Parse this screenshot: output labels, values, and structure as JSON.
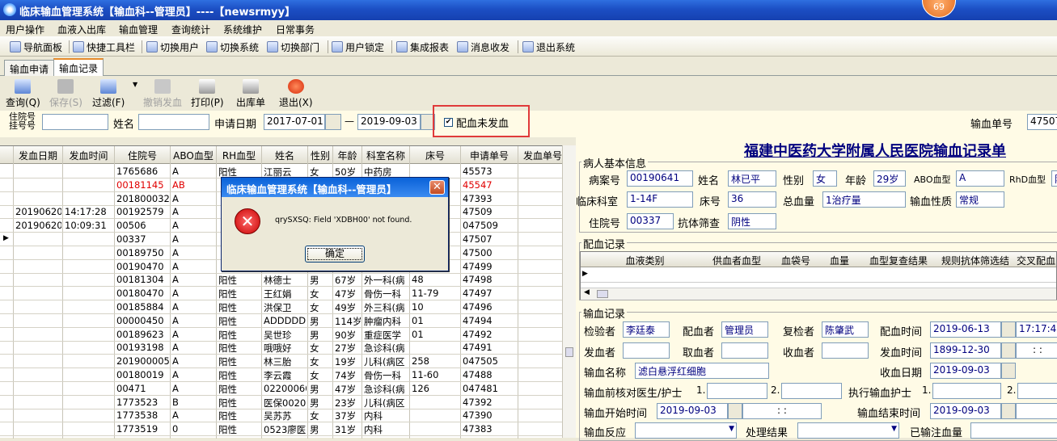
{
  "window": {
    "title": "临床输血管理系统【输血科--管理员】----【newsrmyy】",
    "badge": "69"
  },
  "menu": [
    "用户操作",
    "血液入出库",
    "输血管理",
    "查询统计",
    "系统维护",
    "日常事务"
  ],
  "toolbar": [
    "导航面板",
    "快捷工具栏",
    "切换用户",
    "切换系统",
    "切换部门",
    "用户锁定",
    "集成报表",
    "消息收发",
    "退出系统"
  ],
  "tabs": [
    "输血申请",
    "输血记录"
  ],
  "bigtools": [
    "查询(Q)",
    "保存(S)",
    "过滤(F)",
    "撤销发血",
    "打印(P)",
    "出库单",
    "退出(X)"
  ],
  "filter": {
    "zyh_label1": "住院号",
    "zyh_label2": "挂号号",
    "name_label": "姓名",
    "date_label": "申请日期",
    "date_from": "2017-07-01",
    "dash": "—",
    "date_to": "2019-09-03",
    "checkbox_label": "配血未发血",
    "sqd_label": "输血单号",
    "sqd_value": "47507"
  },
  "grid": {
    "headers": [
      "发血日期",
      "发血时间",
      "住院号",
      "ABO血型",
      "RH血型",
      "姓名",
      "性别",
      "年龄",
      "科室名称",
      "床号",
      "申请单号",
      "发血单号"
    ],
    "rows": [
      [
        "",
        "",
        "1765686",
        "A",
        "阳性",
        "江丽云",
        "女",
        "50岁",
        "中药房",
        "",
        "45573",
        ""
      ],
      [
        "",
        "",
        "00181145",
        "AB",
        "",
        "",
        "",
        "",
        "",
        "",
        "45547",
        ""
      ],
      [
        "",
        "",
        "201800032",
        "A",
        "",
        "",
        "",
        "",
        "",
        "",
        "47393",
        ""
      ],
      [
        "20190620",
        "14:17:28",
        "00192579",
        "A",
        "",
        "",
        "",
        "",
        "",
        "",
        "47509",
        ""
      ],
      [
        "20190620",
        "10:09:31",
        "00506",
        "A",
        "",
        "",
        "",
        "",
        "",
        "",
        "047509",
        ""
      ],
      [
        "",
        "",
        "00337",
        "A",
        "",
        "",
        "",
        "",
        "",
        "",
        "47507",
        ""
      ],
      [
        "",
        "",
        "00189750",
        "A",
        "",
        "",
        "",
        "",
        "",
        "",
        "47500",
        ""
      ],
      [
        "",
        "",
        "00190470",
        "A",
        "",
        "",
        "",
        "",
        "",
        "",
        "47499",
        ""
      ],
      [
        "",
        "",
        "00181304",
        "A",
        "阳性",
        "林德士",
        "男",
        "67岁",
        "外一科(病",
        "48",
        "47498",
        ""
      ],
      [
        "",
        "",
        "00180470",
        "A",
        "阳性",
        "王红娟",
        "女",
        "47岁",
        "骨伤一科",
        "11-79",
        "47497",
        ""
      ],
      [
        "",
        "",
        "00185884",
        "A",
        "阳性",
        "洪保卫",
        "女",
        "49岁",
        "外三科(病",
        "10",
        "47496",
        ""
      ],
      [
        "",
        "",
        "00000450",
        "A",
        "阳性",
        "ADDDDDDD",
        "男",
        "114岁",
        "肿瘤内科",
        "01",
        "47494",
        ""
      ],
      [
        "",
        "",
        "00189623",
        "A",
        "阳性",
        "吴世珍",
        "男",
        "90岁",
        "重症医学",
        "01",
        "47492",
        ""
      ],
      [
        "",
        "",
        "00193198",
        "A",
        "阳性",
        "哦哦好",
        "女",
        "27岁",
        "急诊科(病",
        "",
        "47491",
        ""
      ],
      [
        "",
        "",
        "201900005",
        "A",
        "阳性",
        "林三胎",
        "女",
        "19岁",
        "儿科(病区",
        "258",
        "047505",
        ""
      ],
      [
        "",
        "",
        "00180019",
        "A",
        "阳性",
        "李云霞",
        "女",
        "74岁",
        "骨伤一科",
        "11-60",
        "47488",
        ""
      ],
      [
        "",
        "",
        "00471",
        "A",
        "阳性",
        "02200060",
        "男",
        "47岁",
        "急诊科(病",
        "126",
        "047481",
        ""
      ],
      [
        "",
        "",
        "1773523",
        "B",
        "阳性",
        "医保0020",
        "男",
        "23岁",
        "儿科(病区",
        "",
        "47392",
        ""
      ],
      [
        "",
        "",
        "1773538",
        "A",
        "阳性",
        "吴苏苏",
        "女",
        "37岁",
        "内科",
        "",
        "47390",
        ""
      ],
      [
        "",
        "",
        "1773519",
        "0",
        "阳性",
        "0523廖医",
        "男",
        "31岁",
        "内科",
        "",
        "47383",
        ""
      ]
    ]
  },
  "form": {
    "title": "福建中医药大学附属人民医院输血记录单",
    "patient_group": "病人基本信息",
    "bah_label": "病案号",
    "bah": "00190641",
    "name_label": "姓名",
    "name": "林已平",
    "sex_label": "性别",
    "sex": "女",
    "age_label": "年龄",
    "age": "29岁",
    "abo_label": "ABO血型",
    "abo": "A",
    "rhd_label": "RhD血型",
    "rhd": "阳",
    "dept_label": "临床科室",
    "dept": "1-14F",
    "bed_label": "床号",
    "bed": "36",
    "total_label": "总血量",
    "total": "1治疗量",
    "nature_label": "输血性质",
    "nature": "常规",
    "zyh_label": "住院号",
    "zyh": "00337",
    "screen_label": "抗体筛查",
    "screen": "阴性",
    "match_group": "配血记录",
    "match_headers": [
      "血液类别",
      "供血者血型",
      "血袋号",
      "血量",
      "血型复查结果",
      "规则抗体筛选结",
      "交叉配血"
    ],
    "record_group": "输血记录",
    "jyz_label": "检验者",
    "jyz": "李廷泰",
    "pxz_label": "配血者",
    "pxz": "管理员",
    "fjz_label": "复检者",
    "fjz": "陈肇武",
    "pxsj_label": "配血时间",
    "pxsj": "2019-06-13",
    "pxsj_time": "17:17:4",
    "fxz_label": "发血者",
    "qxz_label": "取血者",
    "sxz_label": "收血者",
    "fxsj_label": "发血时间",
    "fxsj": "1899-12-30",
    "fxsj_time": ": :",
    "sxmc_label": "输血名称",
    "sxmc": "滤白悬浮红细胞",
    "sxrq_label": "收血日期",
    "sxrq": "2019-09-03",
    "hd_label": "输血前核对医生/护士",
    "n1": "1.",
    "n2": "2.",
    "zx_label": "执行输血护士",
    "n3": "1.",
    "n4": "2.",
    "kssj_label": "输血开始时间",
    "kssj": "2019-09-03",
    "kssj_time": ": :",
    "jssj_label": "输血结束时间",
    "jssj": "2019-09-03",
    "fy_label": "输血反应",
    "cljg_label": "处理结果",
    "yzx_label": "已输注血量"
  },
  "dialog": {
    "title": "临床输血管理系统【输血科--管理员】",
    "message": "qrySXSQ: Field 'XDBH00' not found.",
    "ok": "确定"
  }
}
